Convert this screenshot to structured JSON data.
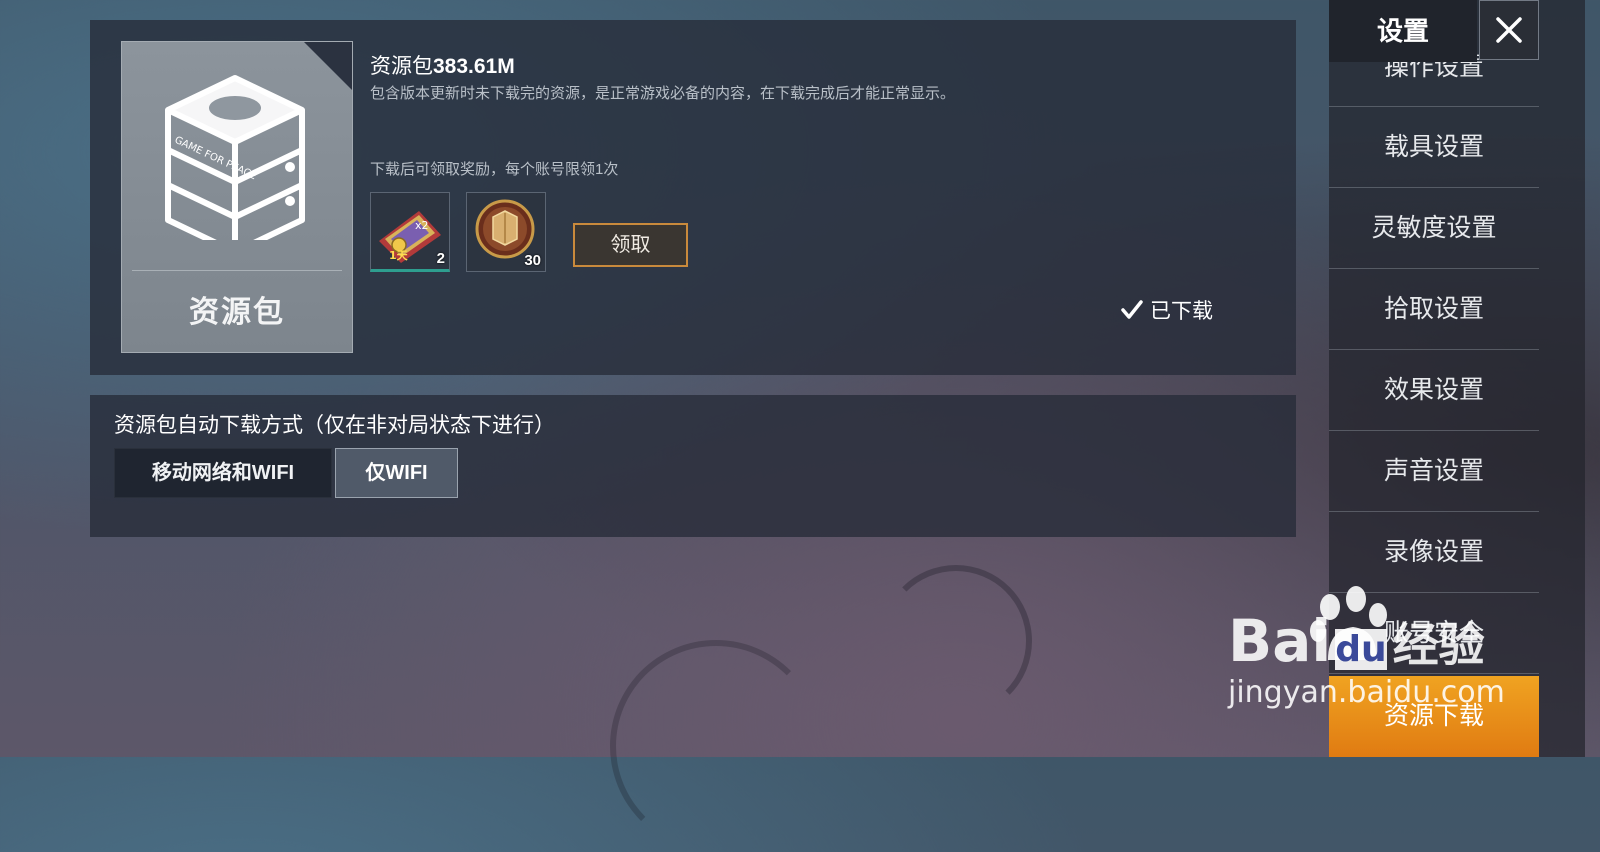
{
  "resource": {
    "title_prefix": "资源包",
    "size": "383.61M",
    "description": "包含版本更新时未下载完的资源，是正常游戏必备的内容，在下载完成后才能正常显示。",
    "reward_note": "下载后可领取奖励，每个账号限领1次",
    "card_label": "资源包",
    "card_box_text": "GAME FOR PEACE",
    "rewards": [
      {
        "icon": "exp-card-icon",
        "badge": "1天",
        "multiplier": "x2",
        "count": "2"
      },
      {
        "icon": "armor-medal-icon",
        "count": "30"
      }
    ],
    "claim_label": "领取",
    "status": "已下载"
  },
  "auto_download": {
    "label": "资源包自动下载方式（仅在非对局状态下进行）",
    "options": [
      "移动网络和WIFI",
      "仅WIFI"
    ],
    "selected": "仅WIFI"
  },
  "sidebar": {
    "title": "设置",
    "items": [
      "操作设置",
      "载具设置",
      "灵敏度设置",
      "拾取设置",
      "效果设置",
      "声音设置",
      "录像设置",
      "账号安全",
      "资源下载"
    ],
    "active": "资源下载"
  },
  "watermark": {
    "brand": "Bai",
    "brand_du": "du",
    "cn": "经验",
    "url": "jingyan.baidu.com"
  },
  "colors": {
    "accent": "#e8901a",
    "claim_border": "#c98a3c",
    "reward_underline": "#2e9e8f"
  }
}
